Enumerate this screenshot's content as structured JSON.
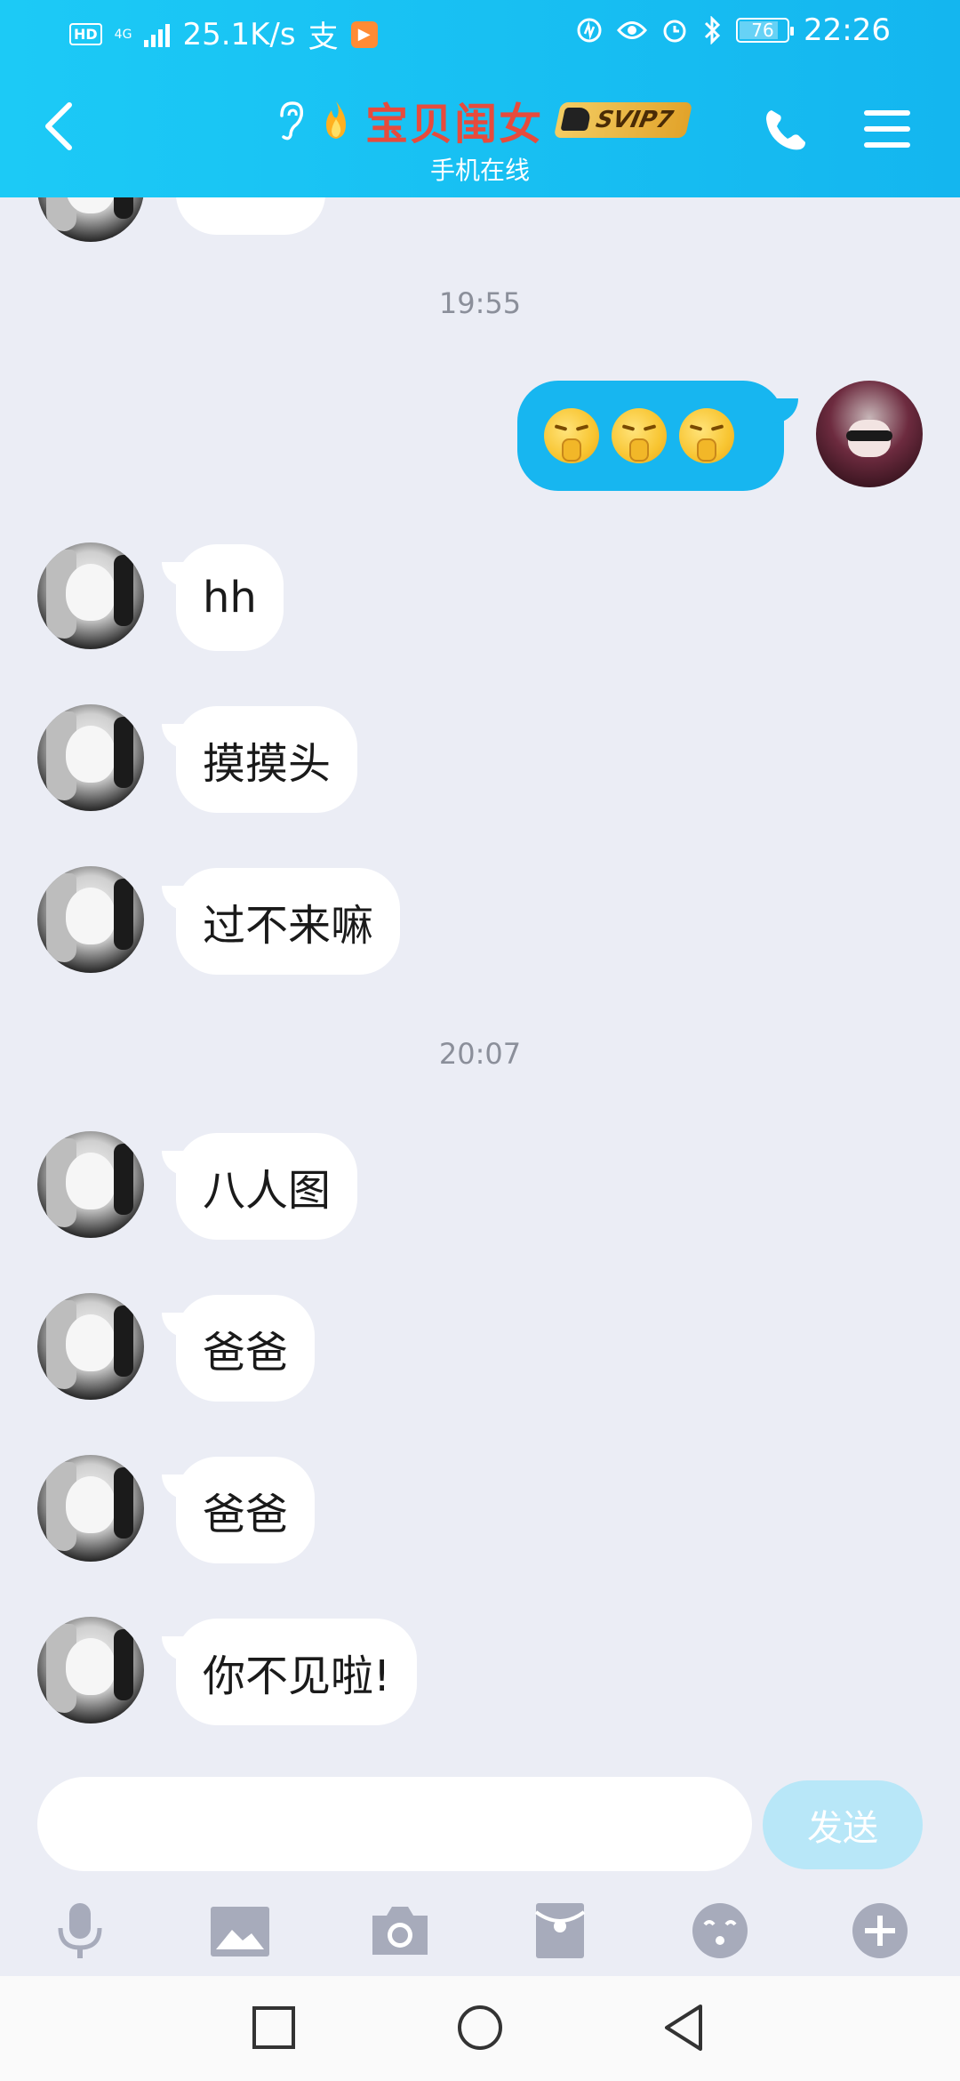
{
  "status_bar": {
    "hd": "HD",
    "network": "4G",
    "speed": "25.1K/s",
    "pay_icon_text": "支",
    "battery": "76",
    "time": "22:26"
  },
  "header": {
    "contact_name": "宝贝闺女",
    "vip_badge": "SVIP7",
    "subtitle": "手机在线"
  },
  "messages": {
    "ts1": "19:55",
    "m2": "hh",
    "m3": "摸摸头",
    "m4": "过不来嘛",
    "ts2": "20:07",
    "m5": "八人图",
    "m6": "爸爸",
    "m7": "爸爸",
    "m8": "你不见啦!"
  },
  "input": {
    "send_label": "发送"
  },
  "colors": {
    "header_start": "#1ccaf6",
    "header_end": "#14b6ef",
    "name": "#e74b3c",
    "self_bubble": "#17b6f0",
    "send_disabled": "#b8e7f8",
    "chat_bg": "#ebedf5"
  },
  "icons": {
    "back": "chevron-left-icon",
    "ear": "ear-icon",
    "flame": "flame-icon",
    "phone": "phone-icon",
    "menu": "menu-icon",
    "voice": "microphone-icon",
    "image": "image-icon",
    "camera": "camera-icon",
    "red_packet": "red-packet-icon",
    "emoji": "emoji-icon",
    "plus": "plus-icon"
  }
}
